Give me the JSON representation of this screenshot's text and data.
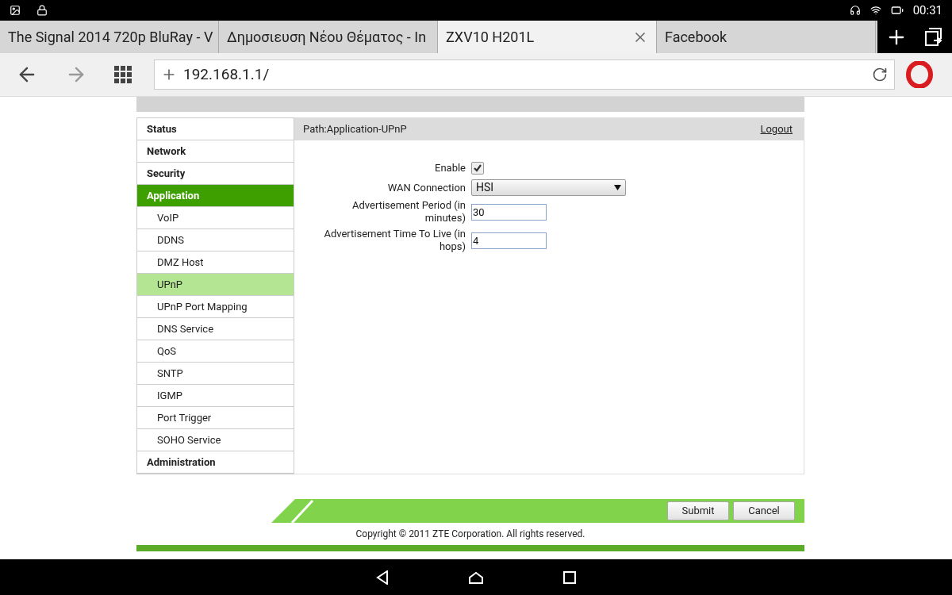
{
  "status_bar": {
    "time": "00:31"
  },
  "tabs": [
    {
      "label": "The Signal 2014 720p BluRay - V",
      "selected": false
    },
    {
      "label": "Δημοσιευση Νέου Θέματος - In",
      "selected": false
    },
    {
      "label": "ZXV10 H201L",
      "selected": true
    },
    {
      "label": "Facebook",
      "selected": false
    }
  ],
  "address_bar": {
    "url": "192.168.1.1/"
  },
  "sidebar": {
    "items": [
      {
        "label": "Status",
        "kind": "section",
        "selected": false
      },
      {
        "label": "Network",
        "kind": "section",
        "selected": false
      },
      {
        "label": "Security",
        "kind": "section",
        "selected": false
      },
      {
        "label": "Application",
        "kind": "section",
        "selected": true
      },
      {
        "label": "VoIP",
        "kind": "sub",
        "selected": false
      },
      {
        "label": "DDNS",
        "kind": "sub",
        "selected": false
      },
      {
        "label": "DMZ Host",
        "kind": "sub",
        "selected": false
      },
      {
        "label": "UPnP",
        "kind": "sub",
        "selected": true
      },
      {
        "label": "UPnP Port Mapping",
        "kind": "sub",
        "selected": false
      },
      {
        "label": "DNS Service",
        "kind": "sub",
        "selected": false
      },
      {
        "label": "QoS",
        "kind": "sub",
        "selected": false
      },
      {
        "label": "SNTP",
        "kind": "sub",
        "selected": false
      },
      {
        "label": "IGMP",
        "kind": "sub",
        "selected": false
      },
      {
        "label": "Port Trigger",
        "kind": "sub",
        "selected": false
      },
      {
        "label": "SOHO Service",
        "kind": "sub",
        "selected": false
      },
      {
        "label": "Administration",
        "kind": "section",
        "selected": false
      }
    ]
  },
  "path": "Path:Application-UPnP",
  "logout": "Logout",
  "form": [
    {
      "label": "Enable",
      "kind": "checkbox",
      "checked": true
    },
    {
      "label": "WAN Connection",
      "kind": "select",
      "value": "HSI"
    },
    {
      "label": "Advertisement Period (in minutes)",
      "kind": "text",
      "value": "30"
    },
    {
      "label": "Advertisement Time To Live (in hops)",
      "kind": "text",
      "value": "4"
    }
  ],
  "buttons": [
    "Submit",
    "Cancel"
  ],
  "copyright": "Copyright © 2011 ZTE Corporation. All rights reserved."
}
